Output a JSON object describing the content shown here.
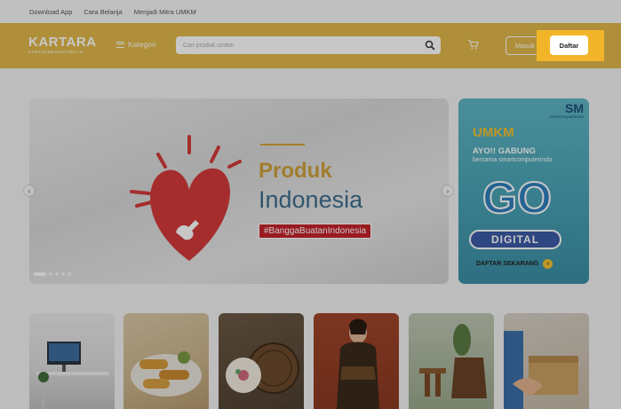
{
  "topbar": {
    "links": [
      "Download App",
      "Cara Belanja",
      "Menjadi Mitra UMKM"
    ]
  },
  "header": {
    "logo_main": "KARTARA",
    "logo_sub": "KARYANDESANTARA.ID",
    "kategori_label": "Kategori",
    "search_placeholder": "Cari produk umkm",
    "masuk_label": "Masuk",
    "daftar_label": "Daftar"
  },
  "hero": {
    "title_line1": "Produk",
    "title_line2": "Indonesia",
    "tag": "#BanggaBuatanIndonesia",
    "slides_total": 5,
    "active_slide": 1,
    "prev_icon": "chevron-left-icon",
    "next_icon": "chevron-right-icon"
  },
  "promo": {
    "brand": "SM",
    "brand_sub": "smartcomputerindo",
    "umkm": "UMKM",
    "ayo": "AYO!! GABUNG",
    "bersama": "bersama smartcomputerindo",
    "go": "GO",
    "digital": "DIGITAL",
    "cta": "DAFTAR SEKARANG"
  },
  "colors": {
    "header_bg": "#e1b84a",
    "highlight": "#f2b52a",
    "tag_red": "#c4232a",
    "title_gold": "#cfa03b",
    "title_blue": "#3d6f8e"
  }
}
